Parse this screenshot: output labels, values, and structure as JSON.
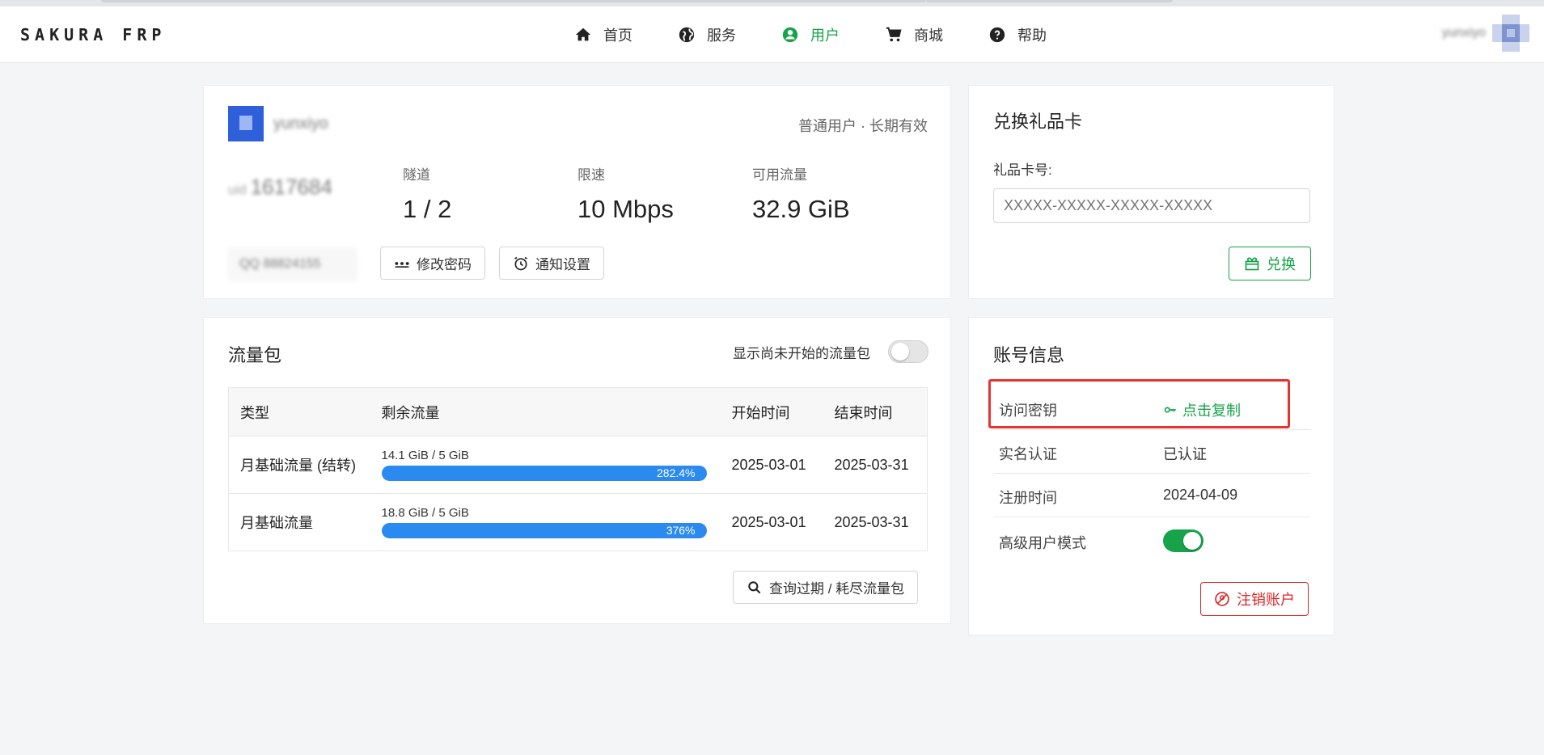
{
  "nav": {
    "brand": "SAKURA FRP",
    "items": [
      {
        "label": "首页",
        "icon": "home-icon"
      },
      {
        "label": "服务",
        "icon": "globe-icon"
      },
      {
        "label": "用户",
        "icon": "user-circle-icon",
        "active": true
      },
      {
        "label": "商城",
        "icon": "cart-icon"
      },
      {
        "label": "帮助",
        "icon": "help-icon"
      }
    ],
    "username": "yunxiyo"
  },
  "user_card": {
    "username": "yunxiyo",
    "role": "普通用户 · 长期有效",
    "id_label": "uid",
    "id_value": "1617684",
    "stats": [
      {
        "label": "隧道",
        "value": "1 / 2"
      },
      {
        "label": "限速",
        "value": "10 Mbps"
      },
      {
        "label": "可用流量",
        "value": "32.9 GiB"
      }
    ],
    "masked_info": "QQ 88824155",
    "change_password": "修改密码",
    "notify_settings": "通知设置"
  },
  "gift_card": {
    "title": "兑换礼品卡",
    "field_label": "礼品卡号:",
    "placeholder": "XXXXX-XXXXX-XXXXX-XXXXX",
    "redeem": "兑换"
  },
  "traffic": {
    "title": "流量包",
    "toggle_label": "显示尚未开始的流量包",
    "toggle_on": false,
    "columns": [
      "类型",
      "剩余流量",
      "开始时间",
      "结束时间"
    ],
    "rows": [
      {
        "type": "月基础流量 (结转)",
        "usage": "14.1 GiB / 5 GiB",
        "percent": "282.4%",
        "start": "2025-03-01",
        "end": "2025-03-31"
      },
      {
        "type": "月基础流量",
        "usage": "18.8 GiB / 5 GiB",
        "percent": "376%",
        "start": "2025-03-01",
        "end": "2025-03-31"
      }
    ],
    "query_button": "查询过期 / 耗尽流量包"
  },
  "account": {
    "title": "账号信息",
    "rows": [
      {
        "key": "访问密钥",
        "value": "点击复制"
      },
      {
        "key": "实名认证",
        "value": "已认证"
      },
      {
        "key": "注册时间",
        "value": "2024-04-09"
      },
      {
        "key": "高级用户模式",
        "value": ""
      }
    ],
    "advanced_mode_on": true,
    "delete_button": "注销账户"
  },
  "colors": {
    "accent": "#16a34a",
    "progress": "#2b8af0",
    "danger": "#dc2626",
    "highlight": "#e63434"
  }
}
